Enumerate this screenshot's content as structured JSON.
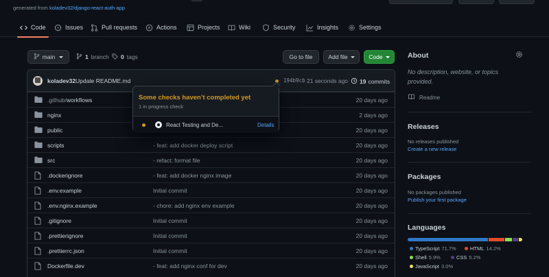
{
  "header": {
    "generated_from_prefix": "generated from",
    "generated_from_repo": "koladev32/django-react-auth-app"
  },
  "tabs": [
    {
      "label": "Code",
      "icon": "code-icon"
    },
    {
      "label": "Issues",
      "icon": "issue-icon"
    },
    {
      "label": "Pull requests",
      "icon": "pull-request-icon"
    },
    {
      "label": "Actions",
      "icon": "play-icon"
    },
    {
      "label": "Projects",
      "icon": "table-icon"
    },
    {
      "label": "Wiki",
      "icon": "book-icon"
    },
    {
      "label": "Security",
      "icon": "shield-icon"
    },
    {
      "label": "Insights",
      "icon": "graph-icon"
    },
    {
      "label": "Settings",
      "icon": "gear-icon"
    }
  ],
  "toolbar": {
    "branch_select": "main",
    "branches_count": "1",
    "branches_label": "branch",
    "tags_count": "0",
    "tags_label": "tags",
    "go_to_file": "Go to file",
    "add_file": "Add file",
    "code": "Code"
  },
  "latest_commit": {
    "author": "koladev32",
    "message": "Update README.md",
    "hash": "194b9cb",
    "time": "21 seconds ago",
    "commit_count": "19",
    "commit_label": "commits",
    "status_color": "#d29922"
  },
  "files": [
    {
      "type": "dir",
      "name_dim": ".github/",
      "name": "workflows",
      "message": "",
      "age": "20 days ago"
    },
    {
      "type": "dir",
      "name_dim": "",
      "name": "nginx",
      "message": "",
      "age": "2 days ago"
    },
    {
      "type": "dir",
      "name_dim": "",
      "name": "public",
      "message": "",
      "age": "20 days ago"
    },
    {
      "type": "dir",
      "name_dim": "",
      "name": "scripts",
      "message": "- feat: add docker deploy script",
      "age": "20 days ago"
    },
    {
      "type": "dir",
      "name_dim": "",
      "name": "src",
      "message": "- refact: format file",
      "age": "20 days ago"
    },
    {
      "type": "file",
      "name_dim": "",
      "name": ".dockerignore",
      "message": "- feat: add docker nginx image",
      "age": "20 days ago"
    },
    {
      "type": "file",
      "name_dim": "",
      "name": ".env.example",
      "message": "Initial commit",
      "age": "20 days ago"
    },
    {
      "type": "file",
      "name_dim": "",
      "name": ".env.nginx.example",
      "message": "- chore: add nginx env example",
      "age": "20 days ago"
    },
    {
      "type": "file",
      "name_dim": "",
      "name": ".gitignore",
      "message": "Initial commit",
      "age": "20 days ago"
    },
    {
      "type": "file",
      "name_dim": "",
      "name": ".prettierignore",
      "message": "Initial commit",
      "age": "20 days ago"
    },
    {
      "type": "file",
      "name_dim": "",
      "name": ".prettierrc.json",
      "message": "Initial commit",
      "age": "20 days ago"
    },
    {
      "type": "file",
      "name_dim": "",
      "name": "Dockerfile.dev",
      "message": "- feat: add nginx conf for dev",
      "age": "20 days ago"
    }
  ],
  "checks_popup": {
    "title": "Some checks haven’t completed yet",
    "subtitle": "1 in progress check",
    "check_name": "React Testing and De...",
    "details_label": "Details"
  },
  "sidebar": {
    "about_title": "About",
    "about_description": "No description, website, or topics provided.",
    "readme_label": "Readme",
    "releases_title": "Releases",
    "releases_empty": "No releases published",
    "releases_link": "Create a new release",
    "packages_title": "Packages",
    "packages_empty": "No packages published",
    "packages_link": "Publish your first package",
    "languages_title": "Languages",
    "languages": [
      {
        "name": "TypeScript",
        "percent": "71.7%",
        "value": 71.7,
        "color": "#3178c6"
      },
      {
        "name": "HTML",
        "percent": "14.2%",
        "value": 14.2,
        "color": "#e34c26"
      },
      {
        "name": "Shell",
        "percent": "5.9%",
        "value": 5.9,
        "color": "#89e051"
      },
      {
        "name": "CSS",
        "percent": "5.2%",
        "value": 5.2,
        "color": "#563d7c"
      },
      {
        "name": "JavaScript",
        "percent": "3.0%",
        "value": 3.0,
        "color": "#f1e05a"
      }
    ]
  }
}
